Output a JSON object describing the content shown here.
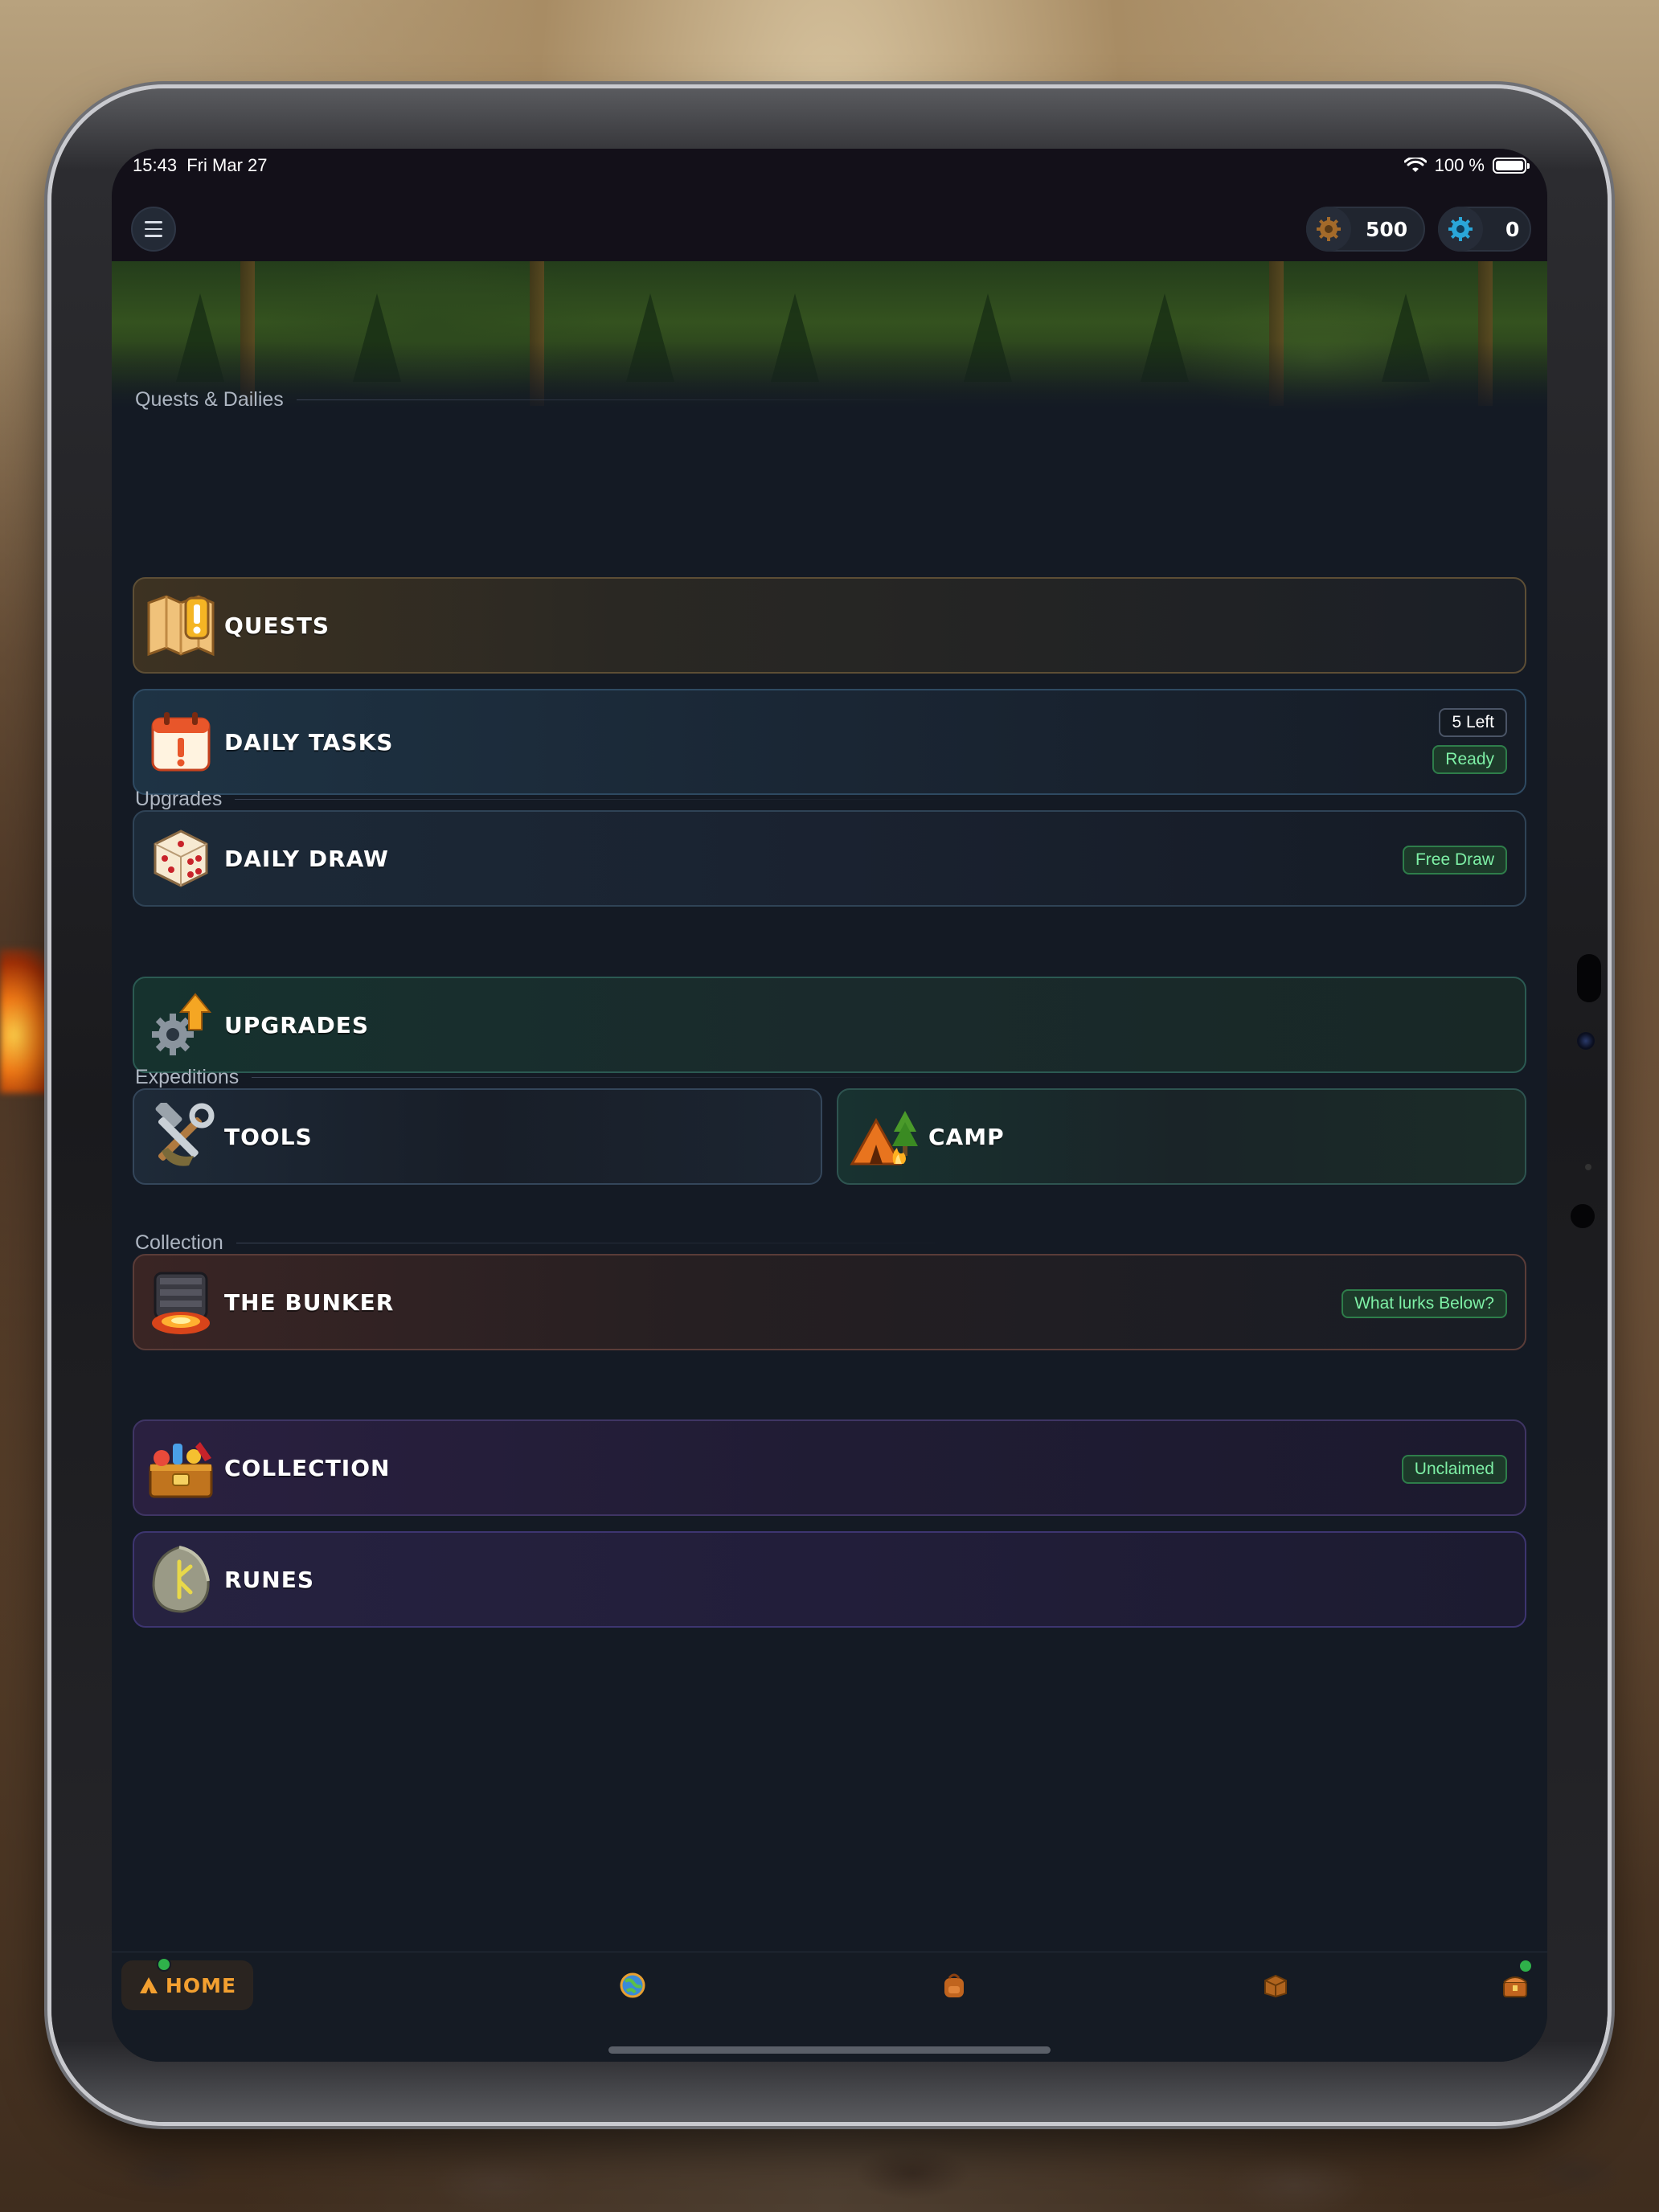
{
  "status": {
    "time": "15:43",
    "date": "Fri Mar 27",
    "battery": "100 %"
  },
  "header": {
    "menu_icon": "hamburger-icon",
    "gold": {
      "icon": "gold-gear-coin-icon",
      "value": "500"
    },
    "gears": {
      "icon": "blue-gear-icon",
      "value": "0"
    }
  },
  "sections": {
    "quests_dailies": "Quests & Dailies",
    "upgrades": "Upgrades",
    "expeditions": "Expeditions",
    "collection": "Collection"
  },
  "cards": {
    "quests": {
      "title": "QUESTS",
      "icon": "map-alert-icon"
    },
    "daily_tasks": {
      "title": "DAILY TASKS",
      "icon": "calendar-alert-icon",
      "badge_count": "5 Left",
      "badge_status": "Ready"
    },
    "daily_draw": {
      "title": "DAILY DRAW",
      "icon": "dice-icon",
      "badge": "Free Draw"
    },
    "upgrades": {
      "title": "UPGRADES",
      "icon": "gear-arrow-up-icon"
    },
    "tools": {
      "title": "TOOLS",
      "icon": "hammer-wrench-icon"
    },
    "camp": {
      "title": "CAMP",
      "icon": "tent-campfire-icon"
    },
    "bunker": {
      "title": "THE BUNKER",
      "icon": "bunker-icon",
      "badge": "What lurks Below?"
    },
    "collection": {
      "title": "COLLECTION",
      "icon": "treasure-chest-icon",
      "badge": "Unclaimed"
    },
    "runes": {
      "title": "RUNES",
      "icon": "rune-stone-icon"
    }
  },
  "tabs": {
    "home": {
      "label": "HOME",
      "icon": "tent-icon"
    },
    "world": {
      "icon": "globe-icon"
    },
    "backpack": {
      "icon": "backpack-icon"
    },
    "crate": {
      "icon": "crate-icon"
    },
    "chest": {
      "icon": "chest-icon"
    }
  },
  "colors": {
    "accent_green": "#7ef0a6",
    "home_orange": "#f3a030",
    "notification_green": "#2fb14a"
  }
}
